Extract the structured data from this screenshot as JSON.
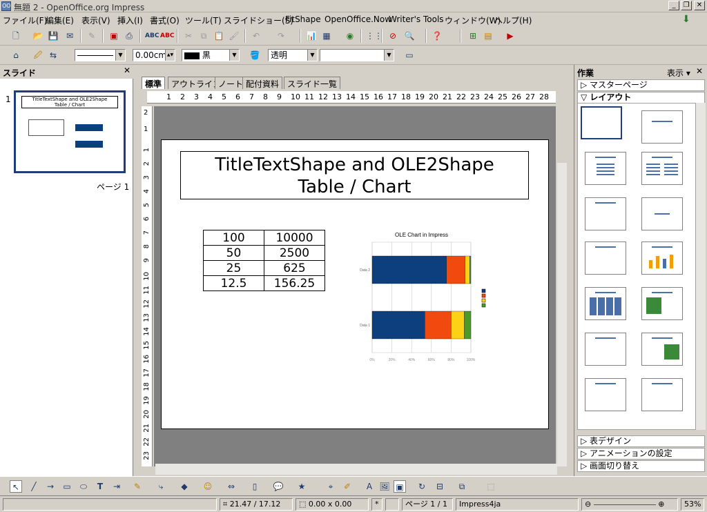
{
  "window": {
    "title": "無題 2 - OpenOffice.org Impress",
    "app_icon": "OO"
  },
  "menu": [
    "ファイル(F)",
    "編集(E)",
    "表示(V)",
    "挿入(I)",
    "書式(O)",
    "ツール(T)",
    "スライドショー(S)",
    "FitShape",
    "OpenOffice.Now",
    "Writer's Tools",
    "ウィンドウ(W)",
    "ヘルプ(H)"
  ],
  "line_toolbar": {
    "line_width": "0.00cm",
    "line_color": "黒",
    "area_style": "透明",
    "area_fill": ""
  },
  "slide_pane": {
    "header": "スライド",
    "slide_number": "1",
    "page_label": "ページ 1"
  },
  "view_tabs": [
    "標準",
    "アウトライン",
    "ノート",
    "配付資料",
    "スライド一覧"
  ],
  "ruler": {
    "h_ticks": [
      "1",
      "2",
      "3",
      "4",
      "5",
      "6",
      "7",
      "8",
      "9",
      "10",
      "11",
      "12",
      "13",
      "14",
      "15",
      "16",
      "17",
      "18",
      "19",
      "20",
      "21",
      "22",
      "23",
      "24",
      "25",
      "26",
      "27",
      "28"
    ],
    "v_ticks_top": [
      "2",
      "1"
    ],
    "v_ticks": [
      "1",
      "2",
      "3",
      "4",
      "5",
      "6",
      "7",
      "8",
      "9",
      "10",
      "11",
      "12",
      "13",
      "14",
      "15",
      "16",
      "17",
      "18",
      "19",
      "20",
      "21",
      "22",
      "23"
    ]
  },
  "slide": {
    "title_line1": "TitleTextShape   and OLE2Shape",
    "title_line2": "Table / Chart",
    "table": [
      [
        "100",
        "10000"
      ],
      [
        "50",
        "2500"
      ],
      [
        "25",
        "625"
      ],
      [
        "12.5",
        "156.25"
      ]
    ],
    "thumb_title_line1": "TitleTextShape   and OLE2Shape",
    "thumb_title_line2": "Table / Chart"
  },
  "chart_data": {
    "type": "bar",
    "orientation": "horizontal",
    "stacked": "percent",
    "title": "OLE Chart in Impress",
    "categories": [
      "Data 2",
      "Data 1"
    ],
    "series": [
      {
        "values": [
          100,
          100
        ],
        "color": "#0d3e7d"
      },
      {
        "values": [
          25,
          50
        ],
        "color": "#f04a0f"
      },
      {
        "values": [
          6.25,
          25
        ],
        "color": "#fcd116"
      },
      {
        "values": [
          1.5625,
          12.5
        ],
        "color": "#4c9a2a"
      }
    ],
    "xlim": [
      0,
      100
    ],
    "x_ticks": [
      "0%",
      "20%",
      "40%",
      "60%",
      "80%",
      "100%"
    ],
    "grid": true
  },
  "task_pane": {
    "header": "作業",
    "view_label": "表示",
    "sections": {
      "master": "マスターページ",
      "layout": "レイアウト",
      "table_design": "表デザイン",
      "animation": "アニメーションの設定",
      "transition": "画面切り替え"
    }
  },
  "status": {
    "position": "21.47 / 17.12",
    "size": "0.00 x 0.00",
    "modified": "*",
    "page": "ページ 1 / 1",
    "master": "Impress4ja",
    "zoom": "53%"
  }
}
